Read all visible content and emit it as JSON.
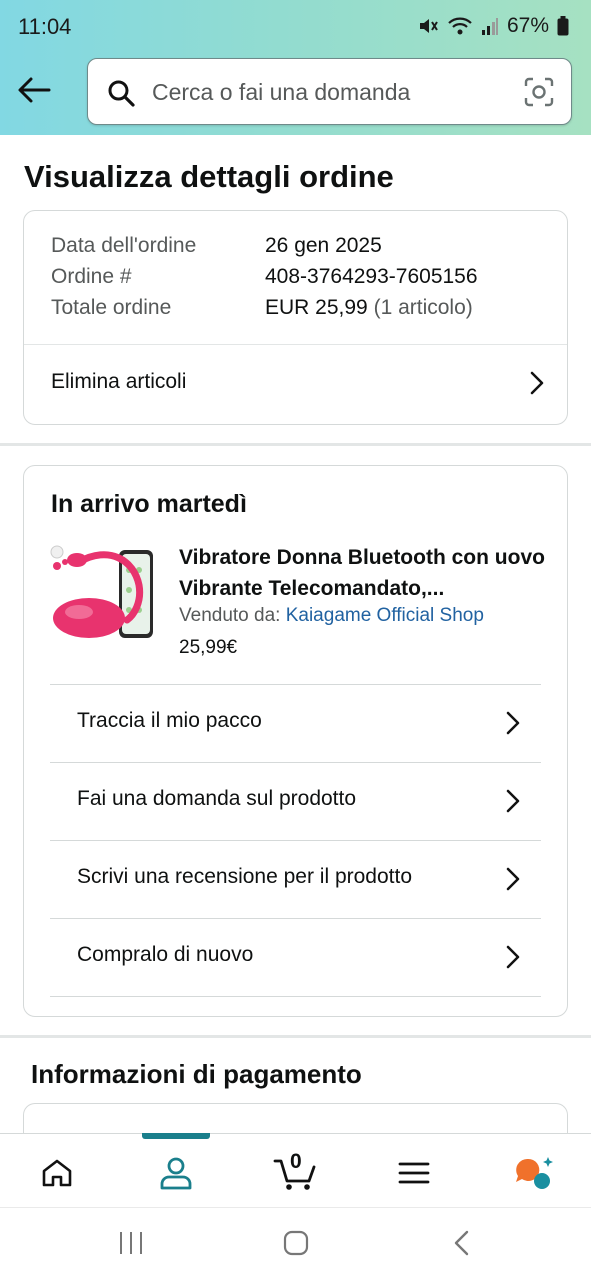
{
  "status_bar": {
    "time": "11:04",
    "battery": "67%"
  },
  "search": {
    "placeholder": "Cerca o fai una domanda"
  },
  "page": {
    "title": "Visualizza dettagli ordine"
  },
  "order_summary": {
    "date_label": "Data dell'ordine",
    "date_value": "26 gen 2025",
    "number_label": "Ordine #",
    "number_value": "408-3764293-7605156",
    "total_label": "Totale ordine",
    "total_value": "EUR 25,99",
    "total_items": "(1 articolo)",
    "delete_items_label": "Elimina articoli"
  },
  "shipment": {
    "arrival_heading": "In arrivo martedì",
    "product_title": "Vibratore Donna Bluetooth con uovo Vibrante Telecomandato,...",
    "seller_prefix": "Venduto da:",
    "seller_name": "Kaiagame Official Shop",
    "price": "25,99€",
    "actions": [
      {
        "label": "Traccia il mio pacco"
      },
      {
        "label": "Fai una domanda sul prodotto"
      },
      {
        "label": "Scrivi una recensione per il prodotto"
      },
      {
        "label": "Compralo di nuovo"
      }
    ]
  },
  "payment": {
    "title": "Informazioni di pagamento"
  },
  "bottom_nav": {
    "cart_count": "0",
    "active_tab": "account"
  },
  "colors": {
    "accent": "#1a7f8c",
    "link": "#2162a1",
    "header_start": "#82d8e3",
    "header_end": "#a6e1c2",
    "product_pink": "#e8336e"
  }
}
